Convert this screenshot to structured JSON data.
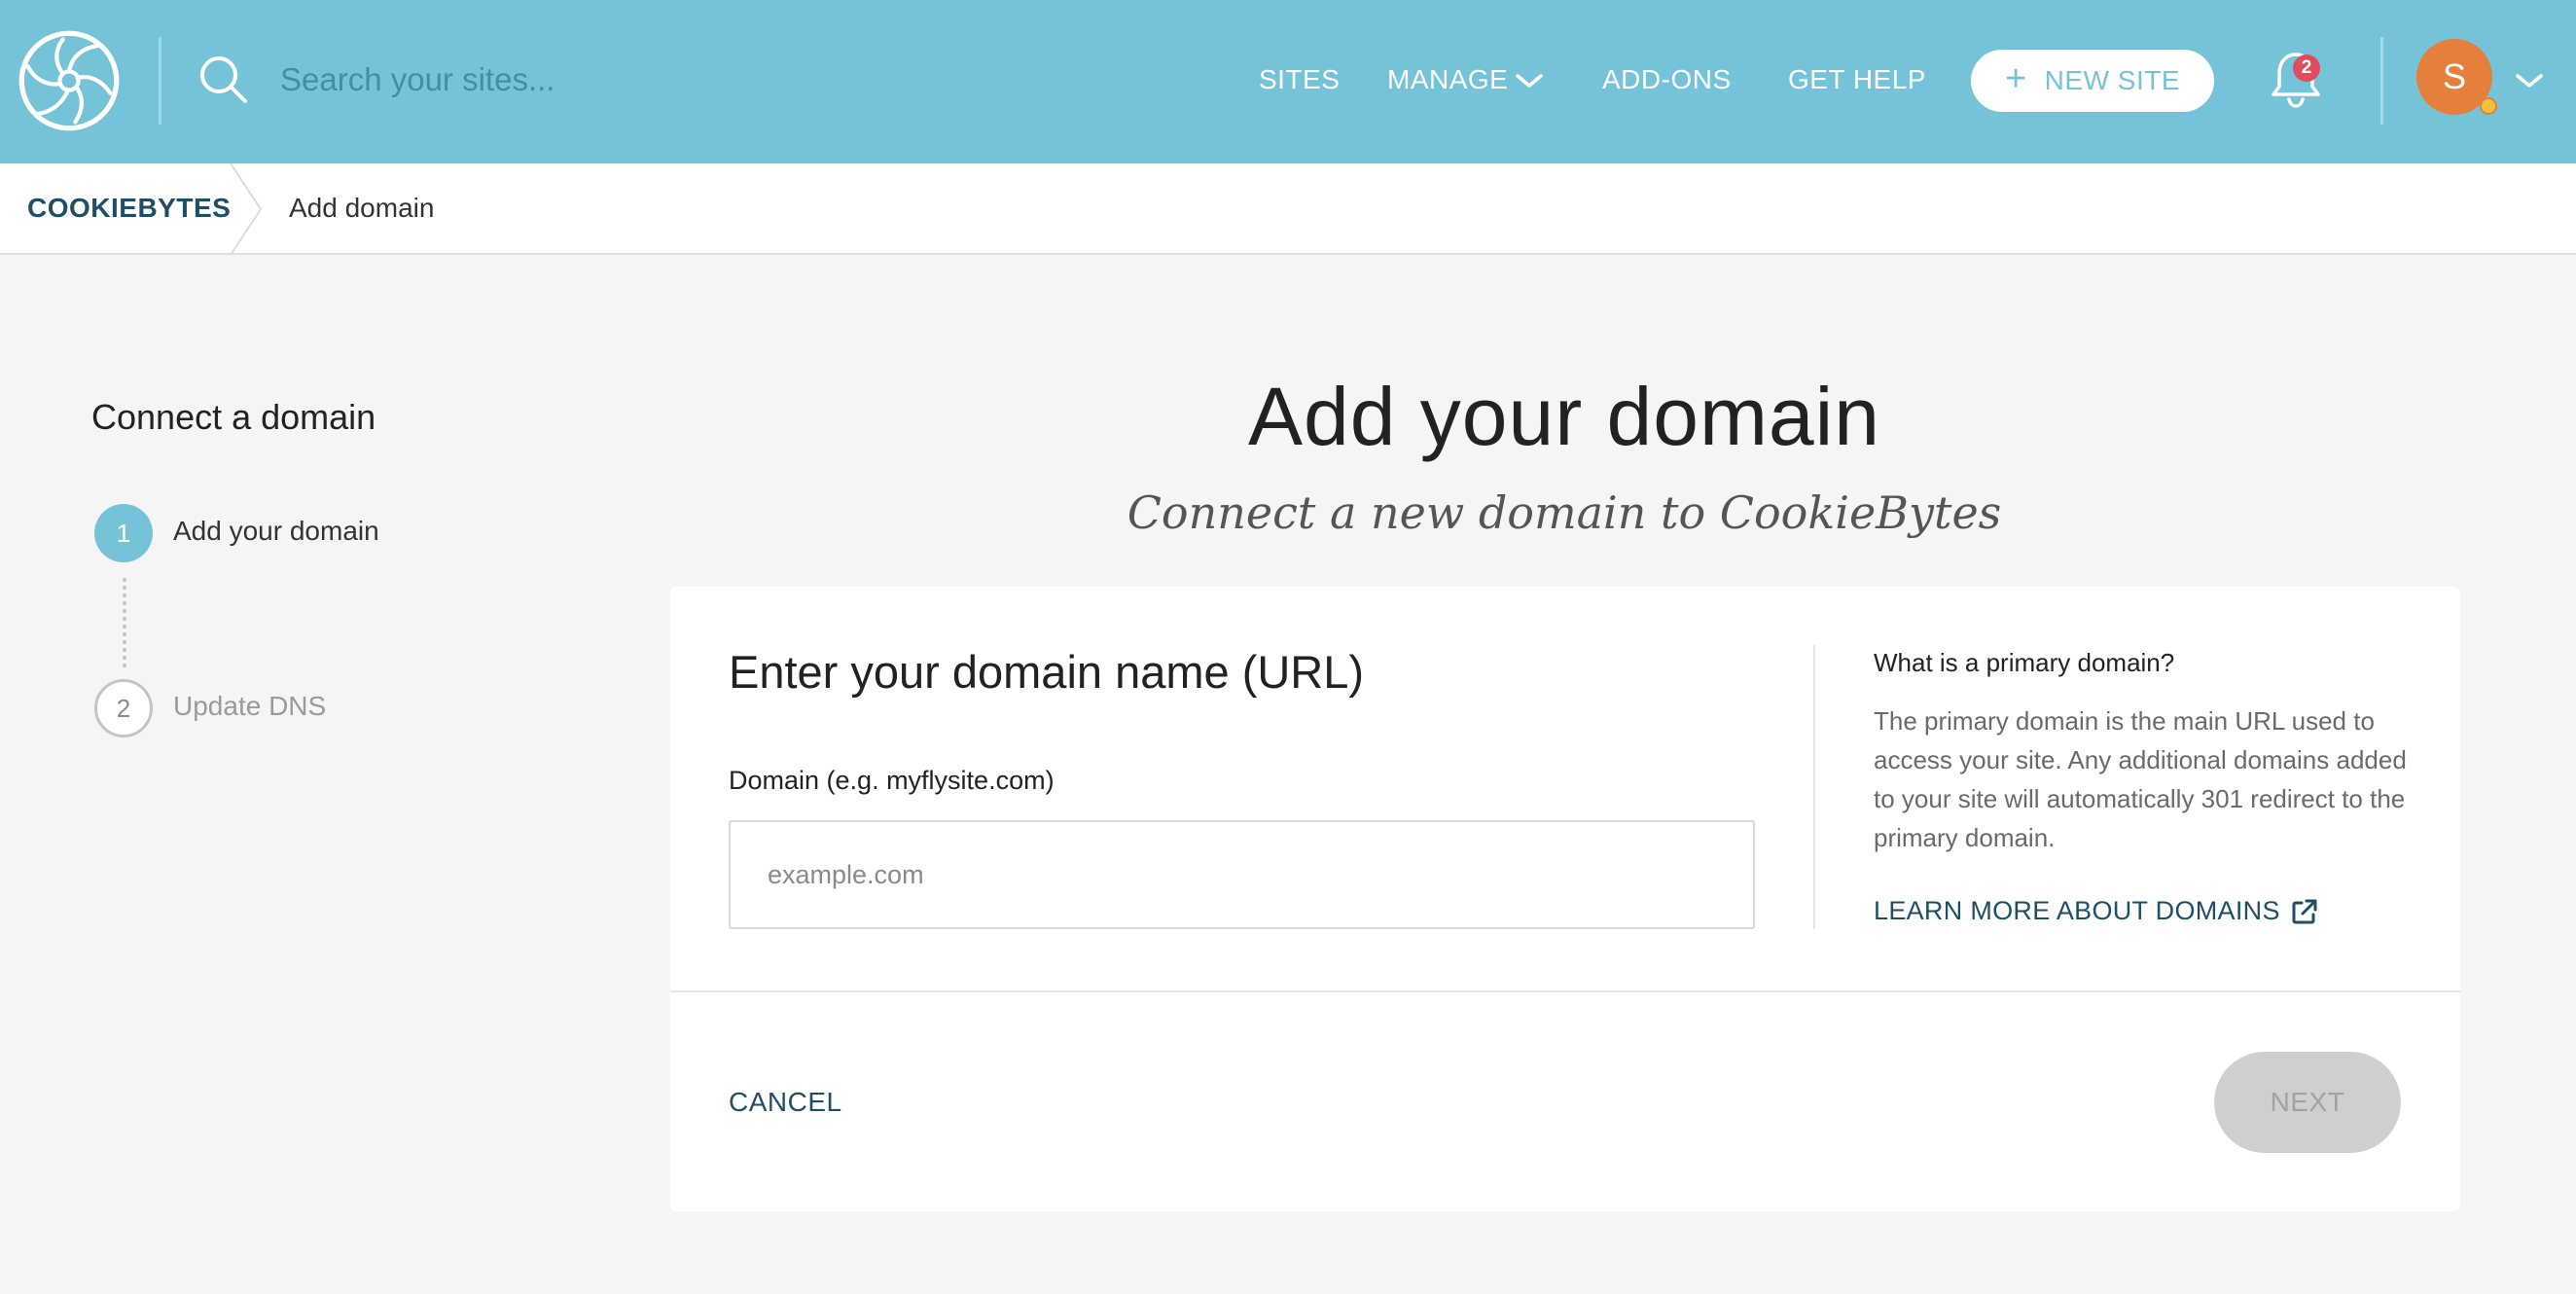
{
  "header": {
    "search_placeholder": "Search your sites...",
    "nav": {
      "sites": "SITES",
      "manage": "MANAGE",
      "addons": "ADD-ONS",
      "help": "GET HELP"
    },
    "new_site_label": "NEW SITE",
    "new_site_plus": "+",
    "notification_count": "2",
    "avatar_initial": "S",
    "colors": {
      "bar": "#74c3d9",
      "avatar": "#e57f3b",
      "badge": "#e04b5d",
      "status_dot": "#f3c23d"
    }
  },
  "breadcrumb": {
    "root": "COOKIEBYTES",
    "current": "Add domain"
  },
  "stepper": {
    "title": "Connect a domain",
    "steps": [
      {
        "number": "1",
        "label": "Add your domain",
        "state": "active"
      },
      {
        "number": "2",
        "label": "Update DNS",
        "state": "pending"
      }
    ]
  },
  "page": {
    "title": "Add your domain",
    "subtitle": "Connect a new domain to CookieBytes"
  },
  "card": {
    "heading": "Enter your domain name (URL)",
    "field_label": "Domain (e.g. myflysite.com)",
    "field_placeholder": "example.com",
    "field_value": "",
    "info_title": "What is a primary domain?",
    "info_body": "The primary domain is the main URL used to access your site. Any additional domains added to your site will automatically 301 redirect to the primary domain.",
    "learn_more": "LEARN MORE ABOUT DOMAINS",
    "cancel": "CANCEL",
    "next": "NEXT"
  }
}
